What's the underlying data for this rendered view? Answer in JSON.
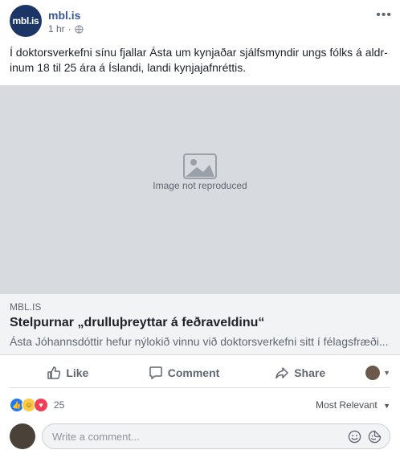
{
  "page": {
    "name": "mbl.is",
    "logo_text": "mbl.is",
    "timestamp": "1 hr",
    "separator": "·"
  },
  "post": {
    "text": "Í doktorsverkefni sínu fjallar Ásta um kynjaðar sjálfsmyndir ungs fólks á aldr-inum 18 til 25 ára á Íslandi, landi kynjajafnréttis."
  },
  "photo": {
    "notice": "Image not reproduced"
  },
  "link": {
    "domain": "MBL.IS",
    "title": "Stelpurnar „drulluþreyttar á feðraveldinu“",
    "description": "Ásta Jóhannsdóttir hefur nýlokið vinnu við doktorsverkefni sitt í félagsfræði..."
  },
  "actions": {
    "like": "Like",
    "comment": "Comment",
    "share": "Share"
  },
  "reactions": {
    "count": "25",
    "sort": "Most Relevant"
  },
  "comment_input": {
    "placeholder": "Write a comment..."
  },
  "colors": {
    "brand": "#385898",
    "like": "#2078f4",
    "haha": "#fbcb45",
    "love": "#f33e58"
  },
  "icons": [
    "more-icon",
    "globe-icon",
    "like-icon",
    "comment-icon",
    "share-icon",
    "emoji-icon",
    "sticker-icon"
  ]
}
